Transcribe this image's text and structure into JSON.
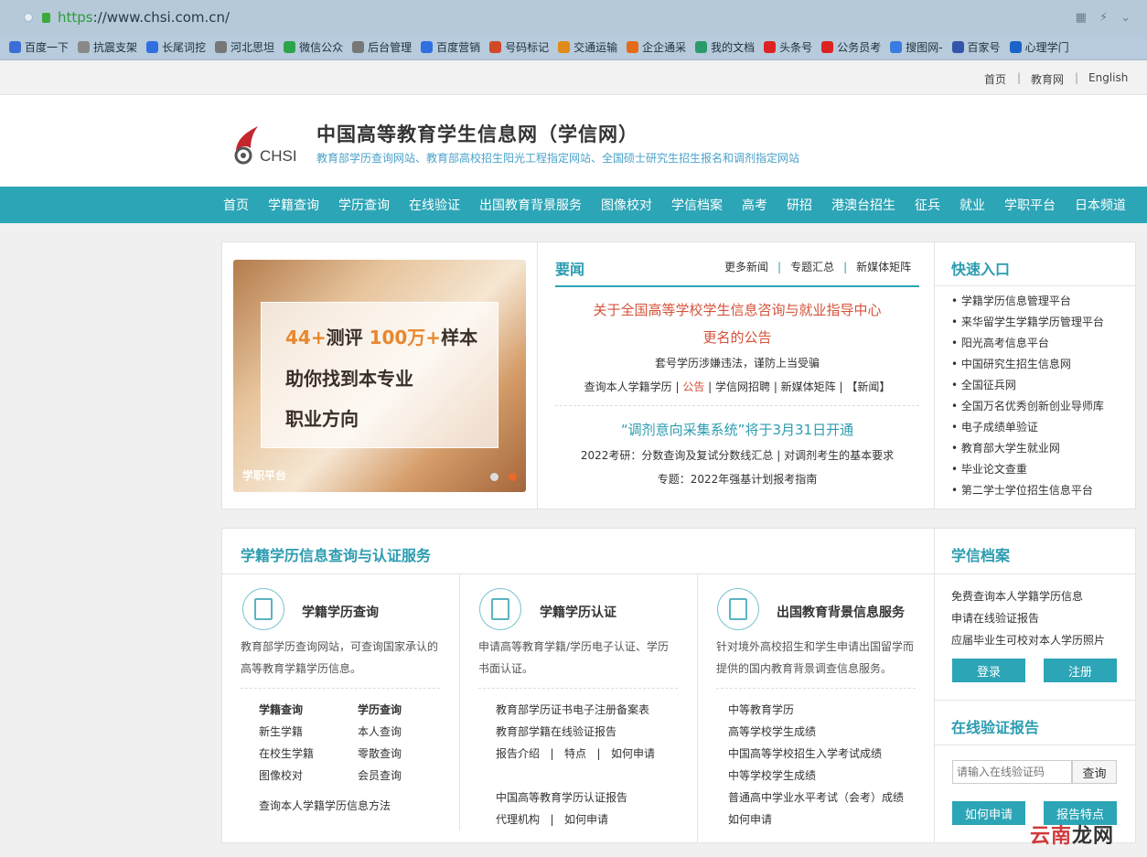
{
  "browser": {
    "url_scheme": "https",
    "url_rest": "://www.chsi.com.cn/",
    "bookmarks": [
      "百度一下",
      "抗震支架",
      "长尾词挖",
      "河北思坦",
      "微信公众",
      "后台管理",
      "百度营销",
      "号码标记",
      "交通运输",
      "企企通采",
      "我的文档",
      "头条号",
      "公务员考",
      "搜图网-",
      "百家号",
      "心理学门"
    ]
  },
  "toplinks": {
    "home": "首页",
    "sep1": "|",
    "edu": "教育网",
    "sep2": "|",
    "en": "English"
  },
  "header": {
    "logo_text": "CHSI",
    "title": "中国高等教育学生信息网（学信网）",
    "subtitle": "教育部学历查询网站、教育部高校招生阳光工程指定网站、全国硕士研究生招生报名和调剂指定网站"
  },
  "nav": [
    "首页",
    "学籍查询",
    "学历查询",
    "在线验证",
    "出国教育背景服务",
    "图像校对",
    "学信档案",
    "高考",
    "研招",
    "港澳台招生",
    "征兵",
    "就业",
    "学职平台",
    "日本频道"
  ],
  "carousel": {
    "num1": "44+",
    "word1": "测评 ",
    "num2": "100万+",
    "word2": "样本",
    "line2": "助你找到本专业",
    "line3": "职业方向",
    "label": "学职平台"
  },
  "news": {
    "heading": "要闻",
    "more": "更多新闻",
    "topics": "专题汇总",
    "media": "新媒体矩阵",
    "headline1": "关于全国高等学校学生信息咨询与就业指导中心",
    "headline1b": "更名的公告",
    "warn": "套号学历涉嫌违法，谨防上当受骗",
    "links1a": "查询本人学籍学历 | ",
    "links1b": "公告",
    "links1c": " | 学信网招聘 | 新媒体矩阵 | 【新闻】",
    "headline2": "“调剂意向采集系统”将于3月31日开通",
    "sub2": "2022考研：分数查询及复试分数线汇总 | 对调剂考生的基本要求",
    "sub3": "专题：2022年强基计划报考指南"
  },
  "quick": {
    "heading": "快速入口",
    "items": [
      "学籍学历信息管理平台",
      "来华留学生学籍学历管理平台",
      "阳光高考信息平台",
      "中国研究生招生信息网",
      "全国征兵网",
      "全国万名优秀创新创业导师库",
      "电子成绩单验证",
      "教育部大学生就业网",
      "毕业论文查重",
      "第二学士学位招生信息平台"
    ]
  },
  "services": {
    "heading": "学籍学历信息查询与认证服务",
    "c1": {
      "title": "学籍学历查询",
      "desc1": "教育部学历查询网站，可查询国家承认的",
      "desc2": "高等教育学籍学历信息。",
      "h1": "学籍查询",
      "h2": "学历查询",
      "a1": "新生学籍",
      "b1": "本人查询",
      "a2": "在校生学籍",
      "b2": "零散查询",
      "a3": "图像校对",
      "b3": "会员查询",
      "foot": "查询本人学籍学历信息方法"
    },
    "c2": {
      "title": "学籍学历认证",
      "desc1": "申请高等教育学籍/学历电子认证、学历",
      "desc2": "书面认证。",
      "l1": "教育部学历证书电子注册备案表",
      "l2": "教育部学籍在线验证报告",
      "g1": "报告介绍",
      "g2": "特点",
      "g3": "如何申请",
      "sep": "|",
      "l3": "中国高等教育学历认证报告",
      "g4": "代理机构",
      "g5": "如何申请"
    },
    "c3": {
      "title": "出国教育背景信息服务",
      "desc1": "针对境外高校招生和学生申请出国留学而",
      "desc2": "提供的国内教育背景调查信息服务。",
      "l1": "中等教育学历",
      "l2": "高等学校学生成绩",
      "l3": "中国高等学校招生入学考试成绩",
      "l4": "中等学校学生成绩",
      "l5": "普通高中学业水平考试（会考）成绩",
      "g1": "如何申请"
    }
  },
  "archive": {
    "heading": "学信档案",
    "l1": "免费查询本人学籍学历信息",
    "l2": "申请在线验证报告",
    "l3": "应届毕业生可校对本人学历照片",
    "login": "登录",
    "register": "注册"
  },
  "verify": {
    "heading": "在线验证报告",
    "placeholder": "请输入在线验证码",
    "query": "查询",
    "how": "如何申请",
    "features": "报告特点"
  },
  "watermark": {
    "a": "云南",
    "b": "龙网"
  }
}
